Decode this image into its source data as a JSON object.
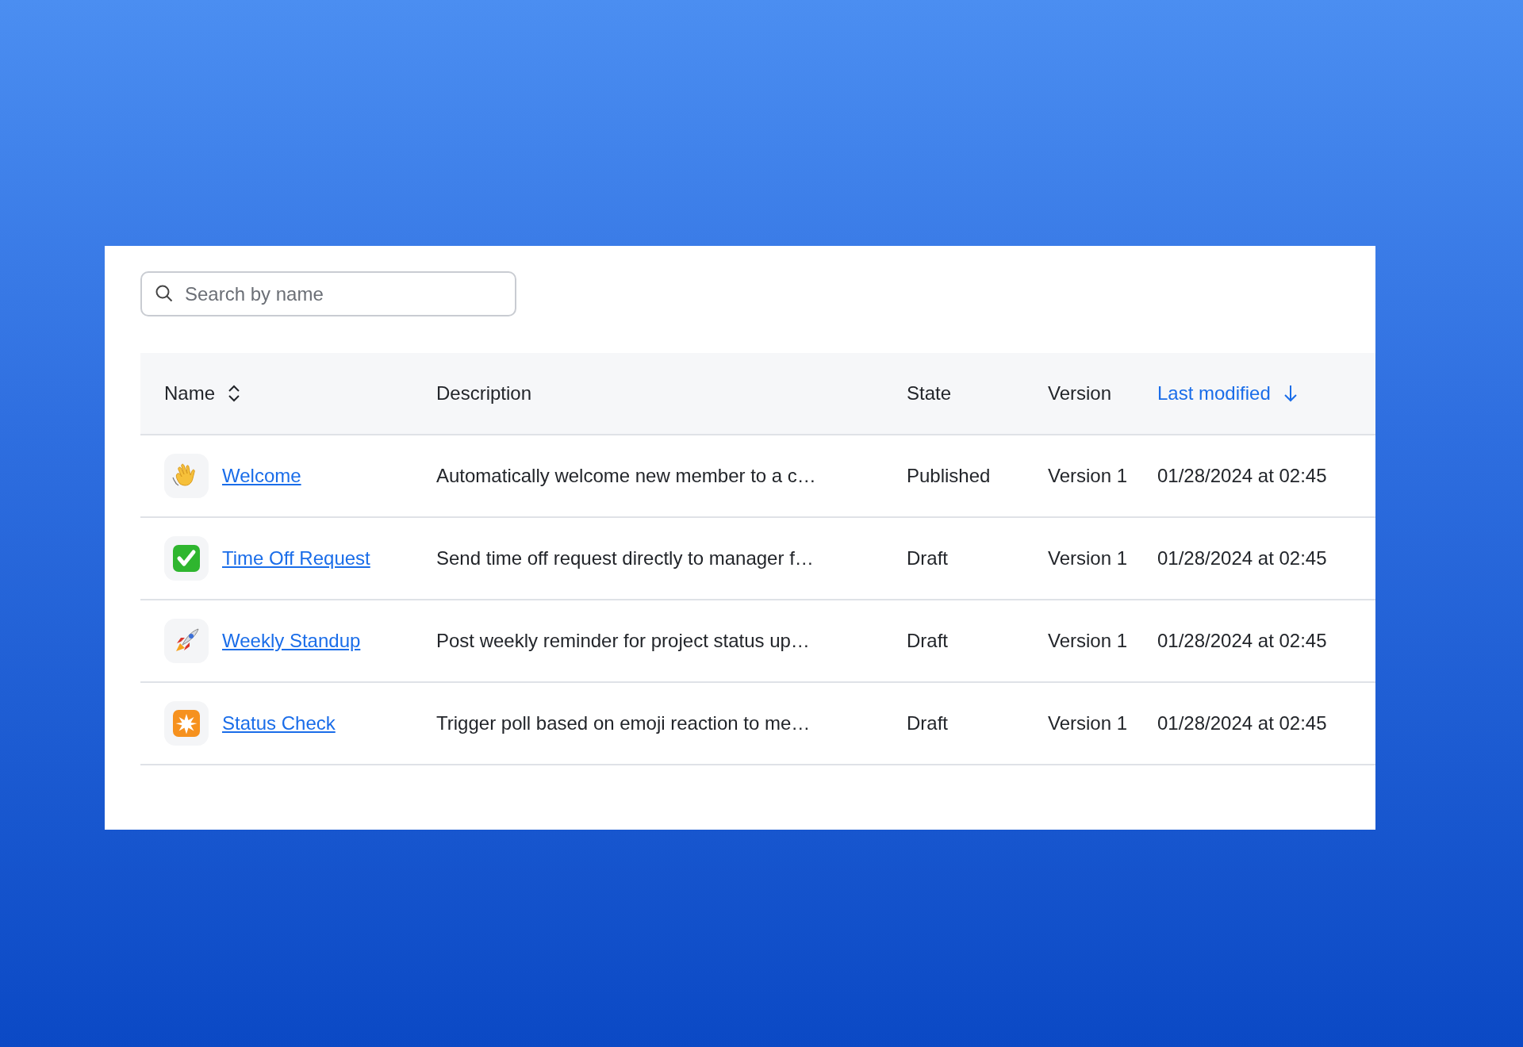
{
  "search": {
    "placeholder": "Search by name"
  },
  "table": {
    "columns": [
      {
        "label": "Name",
        "sortable": true,
        "selected": false
      },
      {
        "label": "Description",
        "sortable": false,
        "selected": false
      },
      {
        "label": "State",
        "sortable": false,
        "selected": false
      },
      {
        "label": "Version",
        "sortable": false,
        "selected": false
      },
      {
        "label": "Last modified",
        "sortable": true,
        "selected": true
      }
    ],
    "rows": [
      {
        "name": "Welcome",
        "description": "Automatically welcome new member to a c…",
        "state": "Published",
        "version": "Version 1",
        "modified": "01/28/2024 at 02:45"
      },
      {
        "name": "Time Off Request",
        "description": "Send time off request directly to manager f…",
        "state": "Draft",
        "version": "Version 1",
        "modified": "01/28/2024 at 02:45"
      },
      {
        "name": "Weekly Standup",
        "description": "Post weekly reminder for project status up…",
        "state": "Draft",
        "version": "Version 1",
        "modified": "01/28/2024 at 02:45"
      },
      {
        "name": "Status Check",
        "description": "Trigger poll based on emoji reaction to me…",
        "state": "Draft",
        "version": "Version 1",
        "modified": "01/28/2024 at 02:45"
      }
    ]
  }
}
